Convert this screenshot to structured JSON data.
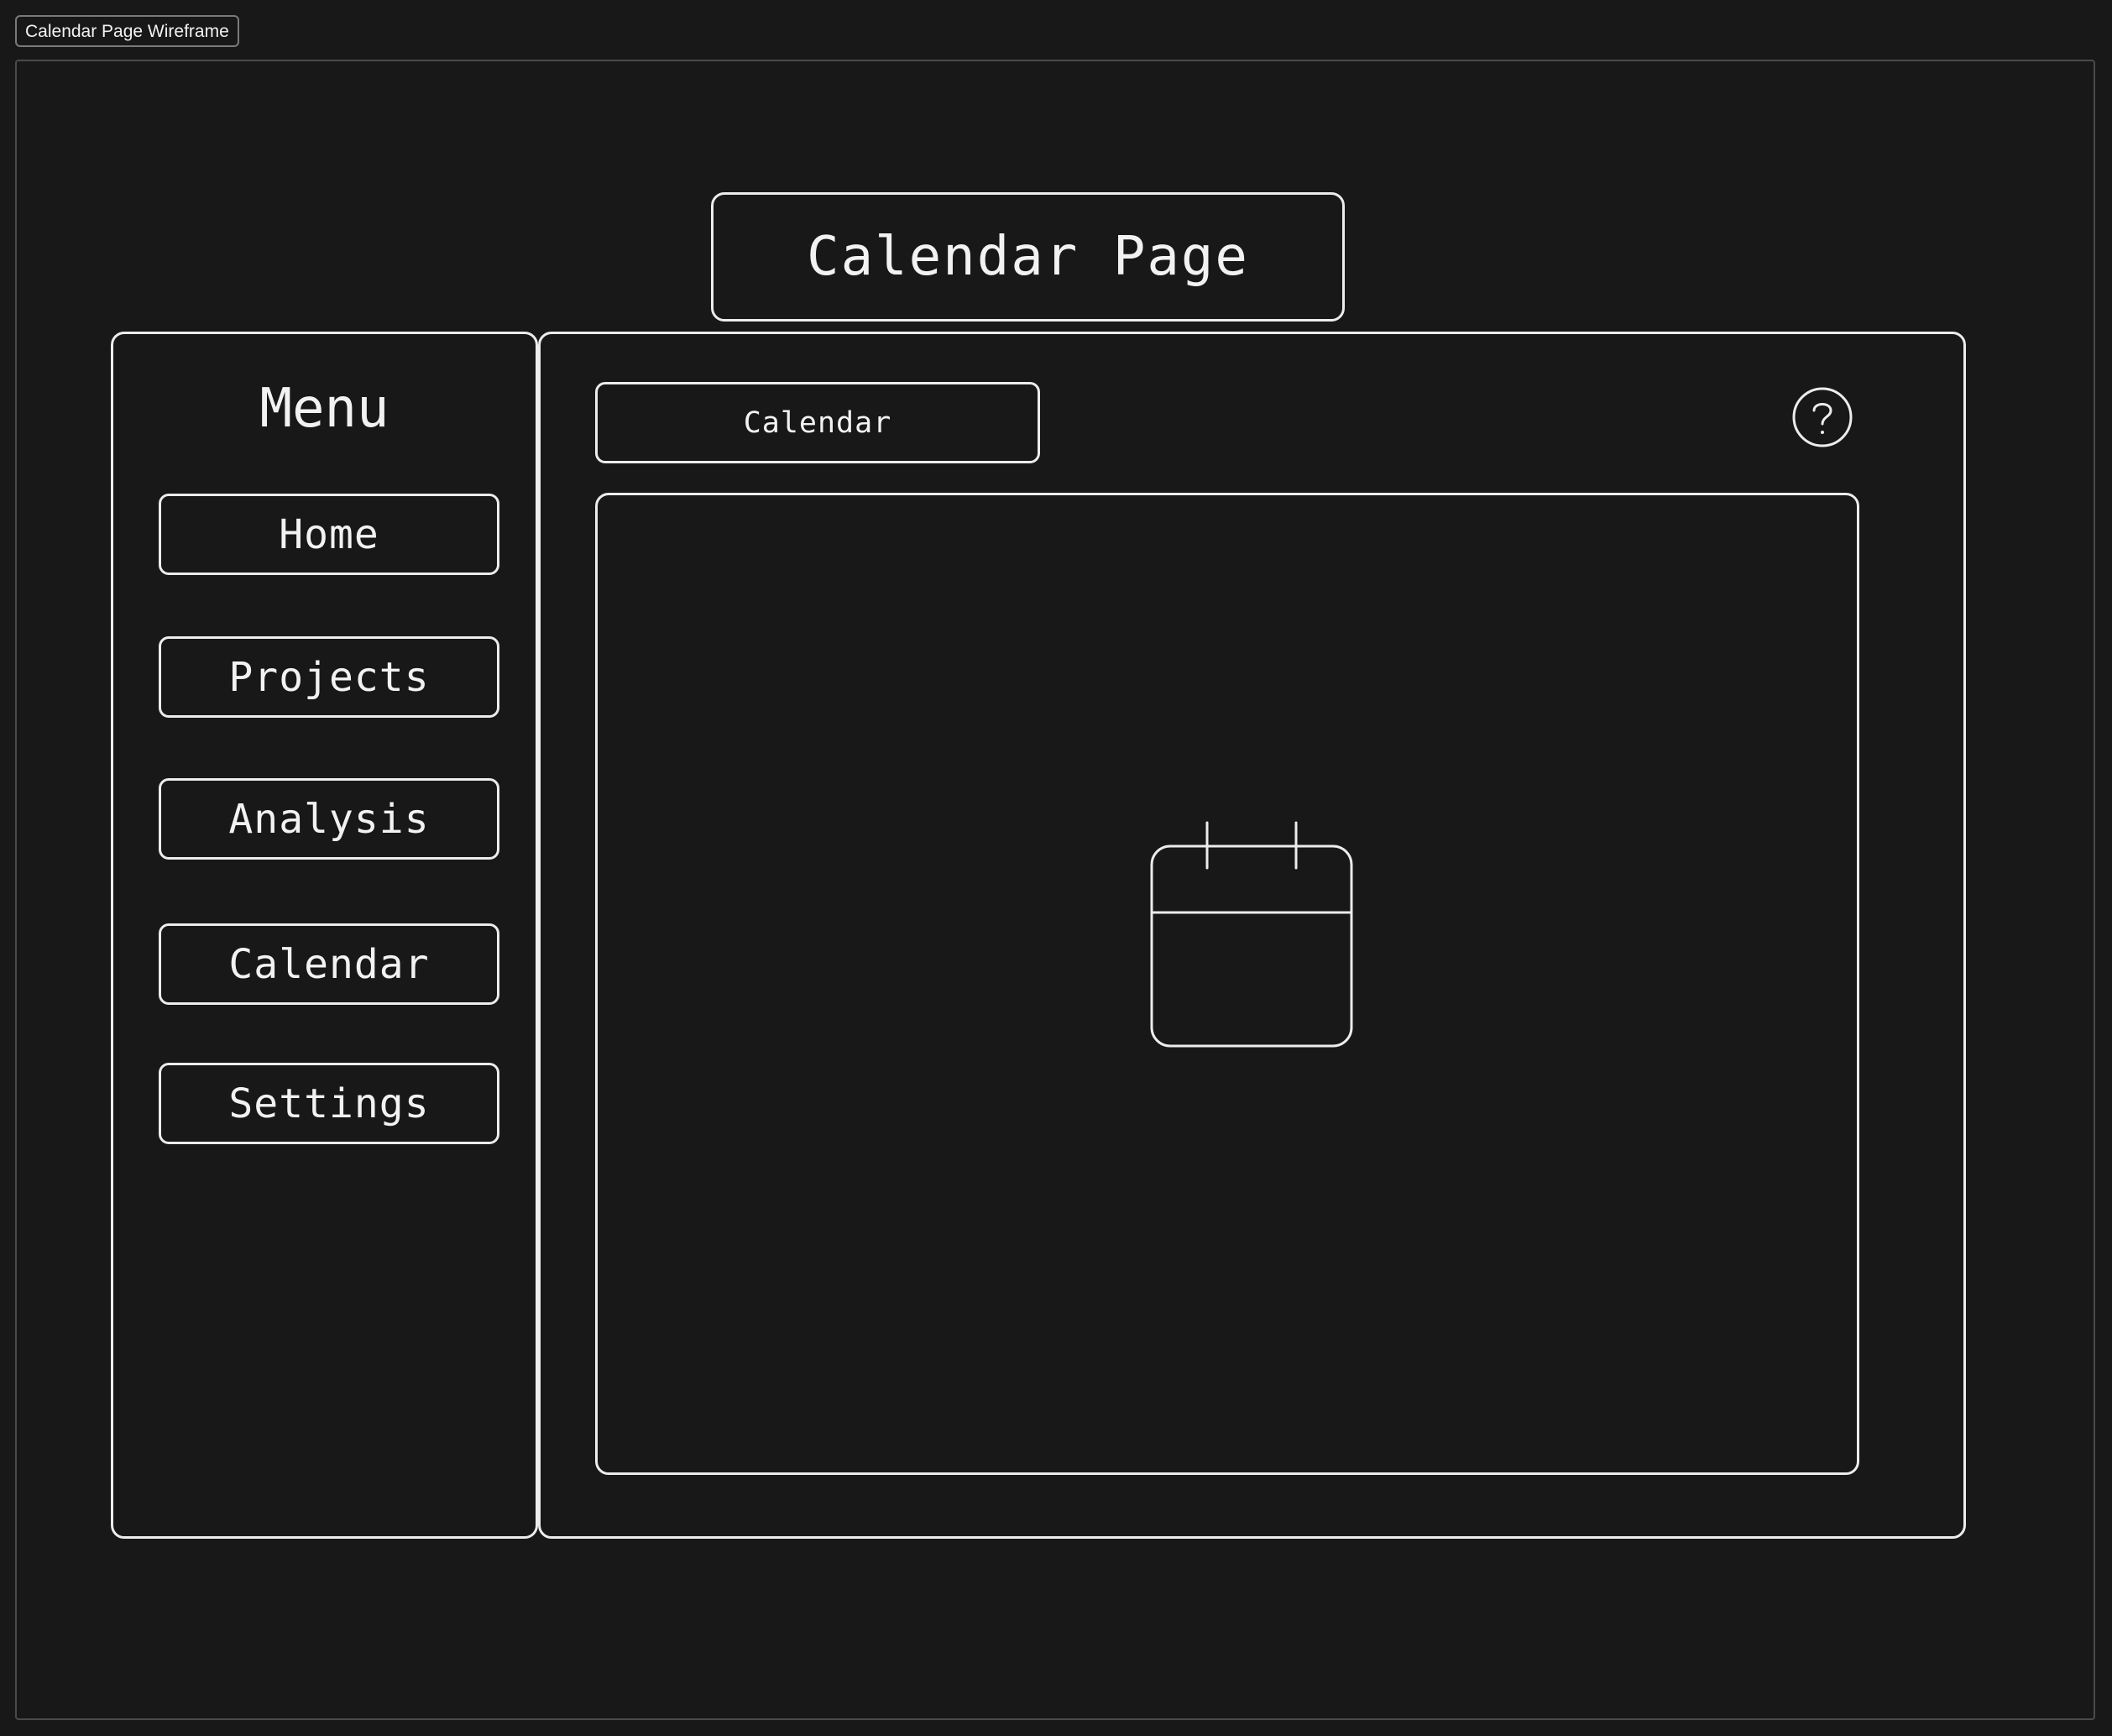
{
  "frame": {
    "label": "Calendar Page Wireframe"
  },
  "header": {
    "title": "Calendar Page"
  },
  "sidebar": {
    "title": "Menu",
    "items": [
      {
        "label": "Home"
      },
      {
        "label": "Projects"
      },
      {
        "label": "Analysis"
      },
      {
        "label": "Calendar"
      },
      {
        "label": "Settings"
      }
    ]
  },
  "main": {
    "tab_label": "Calendar",
    "help_icon": "question-circle-icon",
    "content_icon": "calendar-icon"
  },
  "colors": {
    "background": "#181818",
    "stroke": "#ececec",
    "frame_border": "#4a4a4a"
  }
}
